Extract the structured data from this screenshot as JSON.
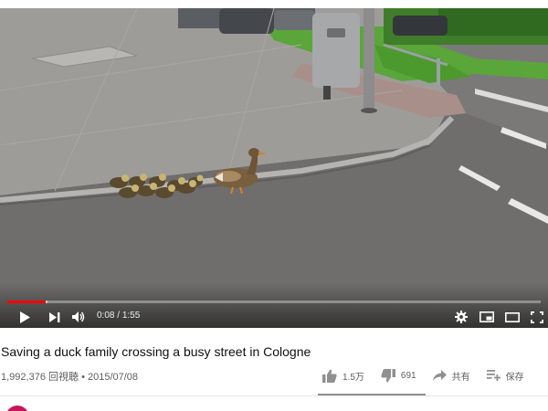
{
  "video": {
    "time_current": "0:08",
    "time_separator": " / ",
    "time_total": "1:55",
    "progress_fraction": 0.072,
    "buffer_fraction": 0.075,
    "controls": {
      "play_icon": "play-icon",
      "next_icon": "skip-next-icon",
      "volume_icon": "volume-icon",
      "settings_icon": "gear-icon",
      "miniplayer_icon": "miniplayer-icon",
      "theater_icon": "theater-mode-icon",
      "fullscreen_icon": "fullscreen-icon"
    },
    "accent_color": "#ff0000"
  },
  "info": {
    "title": "Saving a duck family crossing a busy street in Cologne",
    "views": "1,992,376 回視聴",
    "separator": "•",
    "date": "2015/07/08"
  },
  "actions": {
    "like_count": "1.5万",
    "dislike_count": "691",
    "share_label": "共有",
    "save_label": "保存",
    "like_ratio": 0.956
  }
}
